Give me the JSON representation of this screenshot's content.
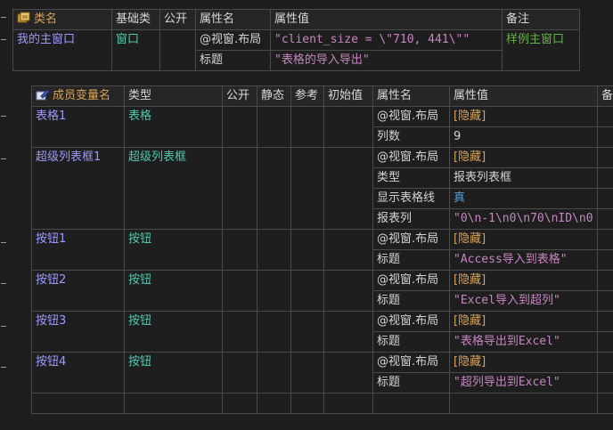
{
  "class_table": {
    "headers": [
      "类名",
      "基础类",
      "公开",
      "属性名",
      "属性值",
      "备注"
    ],
    "class_name": "我的主窗口",
    "base_class": "窗口",
    "public": "",
    "props": [
      {
        "name": "@视窗.布局",
        "value": "\"client_size = \\\"710, 441\\\"\""
      },
      {
        "name": "标题",
        "value": "\"表格的导入导出\""
      }
    ],
    "remark": "样例主窗口"
  },
  "member_table": {
    "headers": [
      "成员变量名",
      "类型",
      "公开",
      "静态",
      "参考",
      "初始值",
      "属性名",
      "属性值",
      "备"
    ],
    "members": [
      {
        "name": "表格1",
        "type": "表格",
        "props": [
          {
            "name": "@视窗.布局",
            "value": "[隐藏]",
            "kind": "hidden"
          },
          {
            "name": "列数",
            "value": "9",
            "kind": "plain"
          }
        ]
      },
      {
        "name": "超级列表框1",
        "type": "超级列表框",
        "props": [
          {
            "name": "@视窗.布局",
            "value": "[隐藏]",
            "kind": "hidden"
          },
          {
            "name": "类型",
            "value": "报表列表框",
            "kind": "plain"
          },
          {
            "name": "显示表格线",
            "value": "真",
            "kind": "bool"
          },
          {
            "name": "报表列",
            "value": "\"0\\n-1\\n0\\n70\\nID\\n0",
            "kind": "str"
          }
        ]
      },
      {
        "name": "按钮1",
        "type": "按钮",
        "props": [
          {
            "name": "@视窗.布局",
            "value": "[隐藏]",
            "kind": "hidden"
          },
          {
            "name": "标题",
            "value": "\"Access导入到表格\"",
            "kind": "str"
          }
        ]
      },
      {
        "name": "按钮2",
        "type": "按钮",
        "props": [
          {
            "name": "@视窗.布局",
            "value": "[隐藏]",
            "kind": "hidden"
          },
          {
            "name": "标题",
            "value": "\"Excel导入到超列\"",
            "kind": "str"
          }
        ]
      },
      {
        "name": "按钮3",
        "type": "按钮",
        "props": [
          {
            "name": "@视窗.布局",
            "value": "[隐藏]",
            "kind": "hidden"
          },
          {
            "name": "标题",
            "value": "\"表格导出到Excel\"",
            "kind": "str"
          }
        ]
      },
      {
        "name": "按钮4",
        "type": "按钮",
        "props": [
          {
            "name": "@视窗.布局",
            "value": "[隐藏]",
            "kind": "hidden"
          },
          {
            "name": "标题",
            "value": "\"超列导出到Excel\"",
            "kind": "str"
          }
        ]
      }
    ]
  },
  "icons": {
    "class_icon": "class-icon",
    "member_icon": "edit-member-icon"
  },
  "colors": {
    "name": "#9a9aff",
    "type": "#4ec9b0",
    "hidden": "#d7a35a",
    "string": "#c586c0",
    "bool": "#569cd6",
    "remark": "#6ab04c"
  }
}
